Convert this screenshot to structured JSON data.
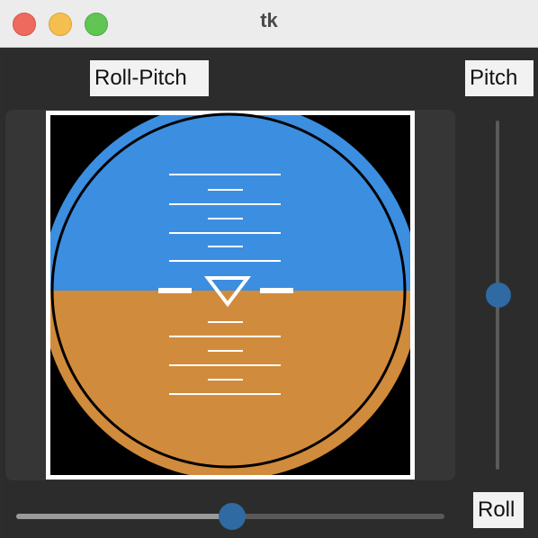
{
  "window": {
    "title": "tk"
  },
  "labels": {
    "roll_pitch": "Roll-Pitch",
    "pitch": "Pitch",
    "roll": "Roll"
  },
  "sliders": {
    "pitch": {
      "orientation": "vertical",
      "position": 0.5
    },
    "roll": {
      "orientation": "horizontal",
      "position": 0.5
    }
  },
  "indicator": {
    "type": "artificial horizon",
    "roll_degrees": 0,
    "pitch_degrees": 0,
    "colors": {
      "sky": "#3c8ee0",
      "ground": "#d18b3c",
      "background": "#000000",
      "frame": "#ffffff",
      "markings": "#ffffff",
      "ring": "#000000"
    }
  },
  "controls": {
    "close": "close-button",
    "minimize": "minimize-button",
    "maximize": "zoom-button"
  }
}
